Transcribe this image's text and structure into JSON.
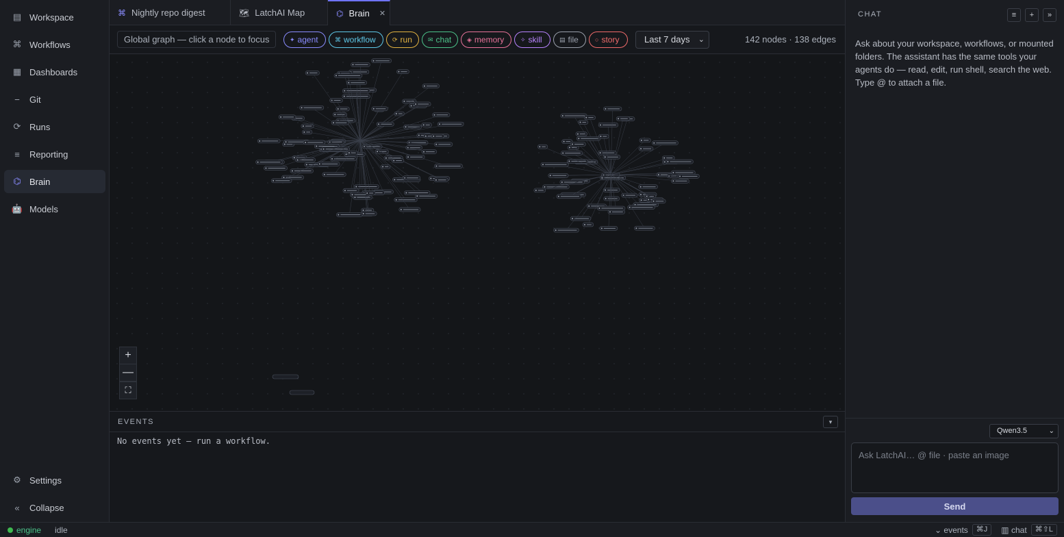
{
  "sidebar": {
    "items": [
      {
        "label": "Workspace",
        "icon": "workspace-icon",
        "glyph": "▤"
      },
      {
        "label": "Workflows",
        "icon": "command-icon",
        "glyph": "⌘"
      },
      {
        "label": "Dashboards",
        "icon": "grid-icon",
        "glyph": "▦"
      },
      {
        "label": "Git",
        "icon": "git-icon",
        "glyph": "⎯"
      },
      {
        "label": "Runs",
        "icon": "runs-icon",
        "glyph": "⟳"
      },
      {
        "label": "Reporting",
        "icon": "list-icon",
        "glyph": "≡"
      },
      {
        "label": "Brain",
        "icon": "brain-icon",
        "glyph": "⌬"
      },
      {
        "label": "Models",
        "icon": "robot-icon",
        "glyph": "🤖"
      }
    ],
    "settings": {
      "label": "Settings",
      "glyph": "⚙"
    },
    "collapse": {
      "label": "Collapse",
      "glyph": "«"
    }
  },
  "tabs": [
    {
      "label": "Nightly repo digest",
      "glyph": "⌘"
    },
    {
      "label": "LatchAI Map",
      "glyph": "🗺"
    },
    {
      "label": "Brain",
      "glyph": "⌬",
      "close": "✕"
    }
  ],
  "toolbar": {
    "scope_label": "Global graph — click a node to focus",
    "chips": [
      {
        "label": "agent",
        "glyph": "✦",
        "color": "#8a8cff"
      },
      {
        "label": "workflow",
        "glyph": "⌘",
        "color": "#5ec8e8"
      },
      {
        "label": "run",
        "glyph": "⟳",
        "color": "#e3b341"
      },
      {
        "label": "chat",
        "glyph": "✉",
        "color": "#4cc38a"
      },
      {
        "label": "memory",
        "glyph": "◈",
        "color": "#e8739a"
      },
      {
        "label": "skill",
        "glyph": "✧",
        "color": "#b884ff"
      },
      {
        "label": "file",
        "glyph": "▤",
        "color": "#9aa0ab"
      },
      {
        "label": "story",
        "glyph": "○",
        "color": "#f06b6b"
      }
    ],
    "range": "Last 7 days",
    "counts": "142 nodes · 138 edges"
  },
  "zoom": {
    "in": "+",
    "out": "—",
    "fit": "⛶"
  },
  "events": {
    "title": "EVENTS",
    "toggle": "▾",
    "empty": "No events yet — run a workflow."
  },
  "chat": {
    "title": "CHAT",
    "buttons": [
      "≡",
      "+",
      "»"
    ],
    "intro": "Ask about your workspace, workflows, or mounted folders. The assistant has the same tools your agents do — read, edit, run shell, search the web. Type @ to attach a file.",
    "model": "Qwen3.5",
    "placeholder": "Ask LatchAI… @ file · paste an image",
    "send": "Send"
  },
  "statusbar": {
    "engine": "engine",
    "state": "idle",
    "events_label": "⌄ events",
    "events_kbd": "⌘J",
    "chat_label": "▥ chat",
    "chat_kbd": "⌘⇧L"
  }
}
